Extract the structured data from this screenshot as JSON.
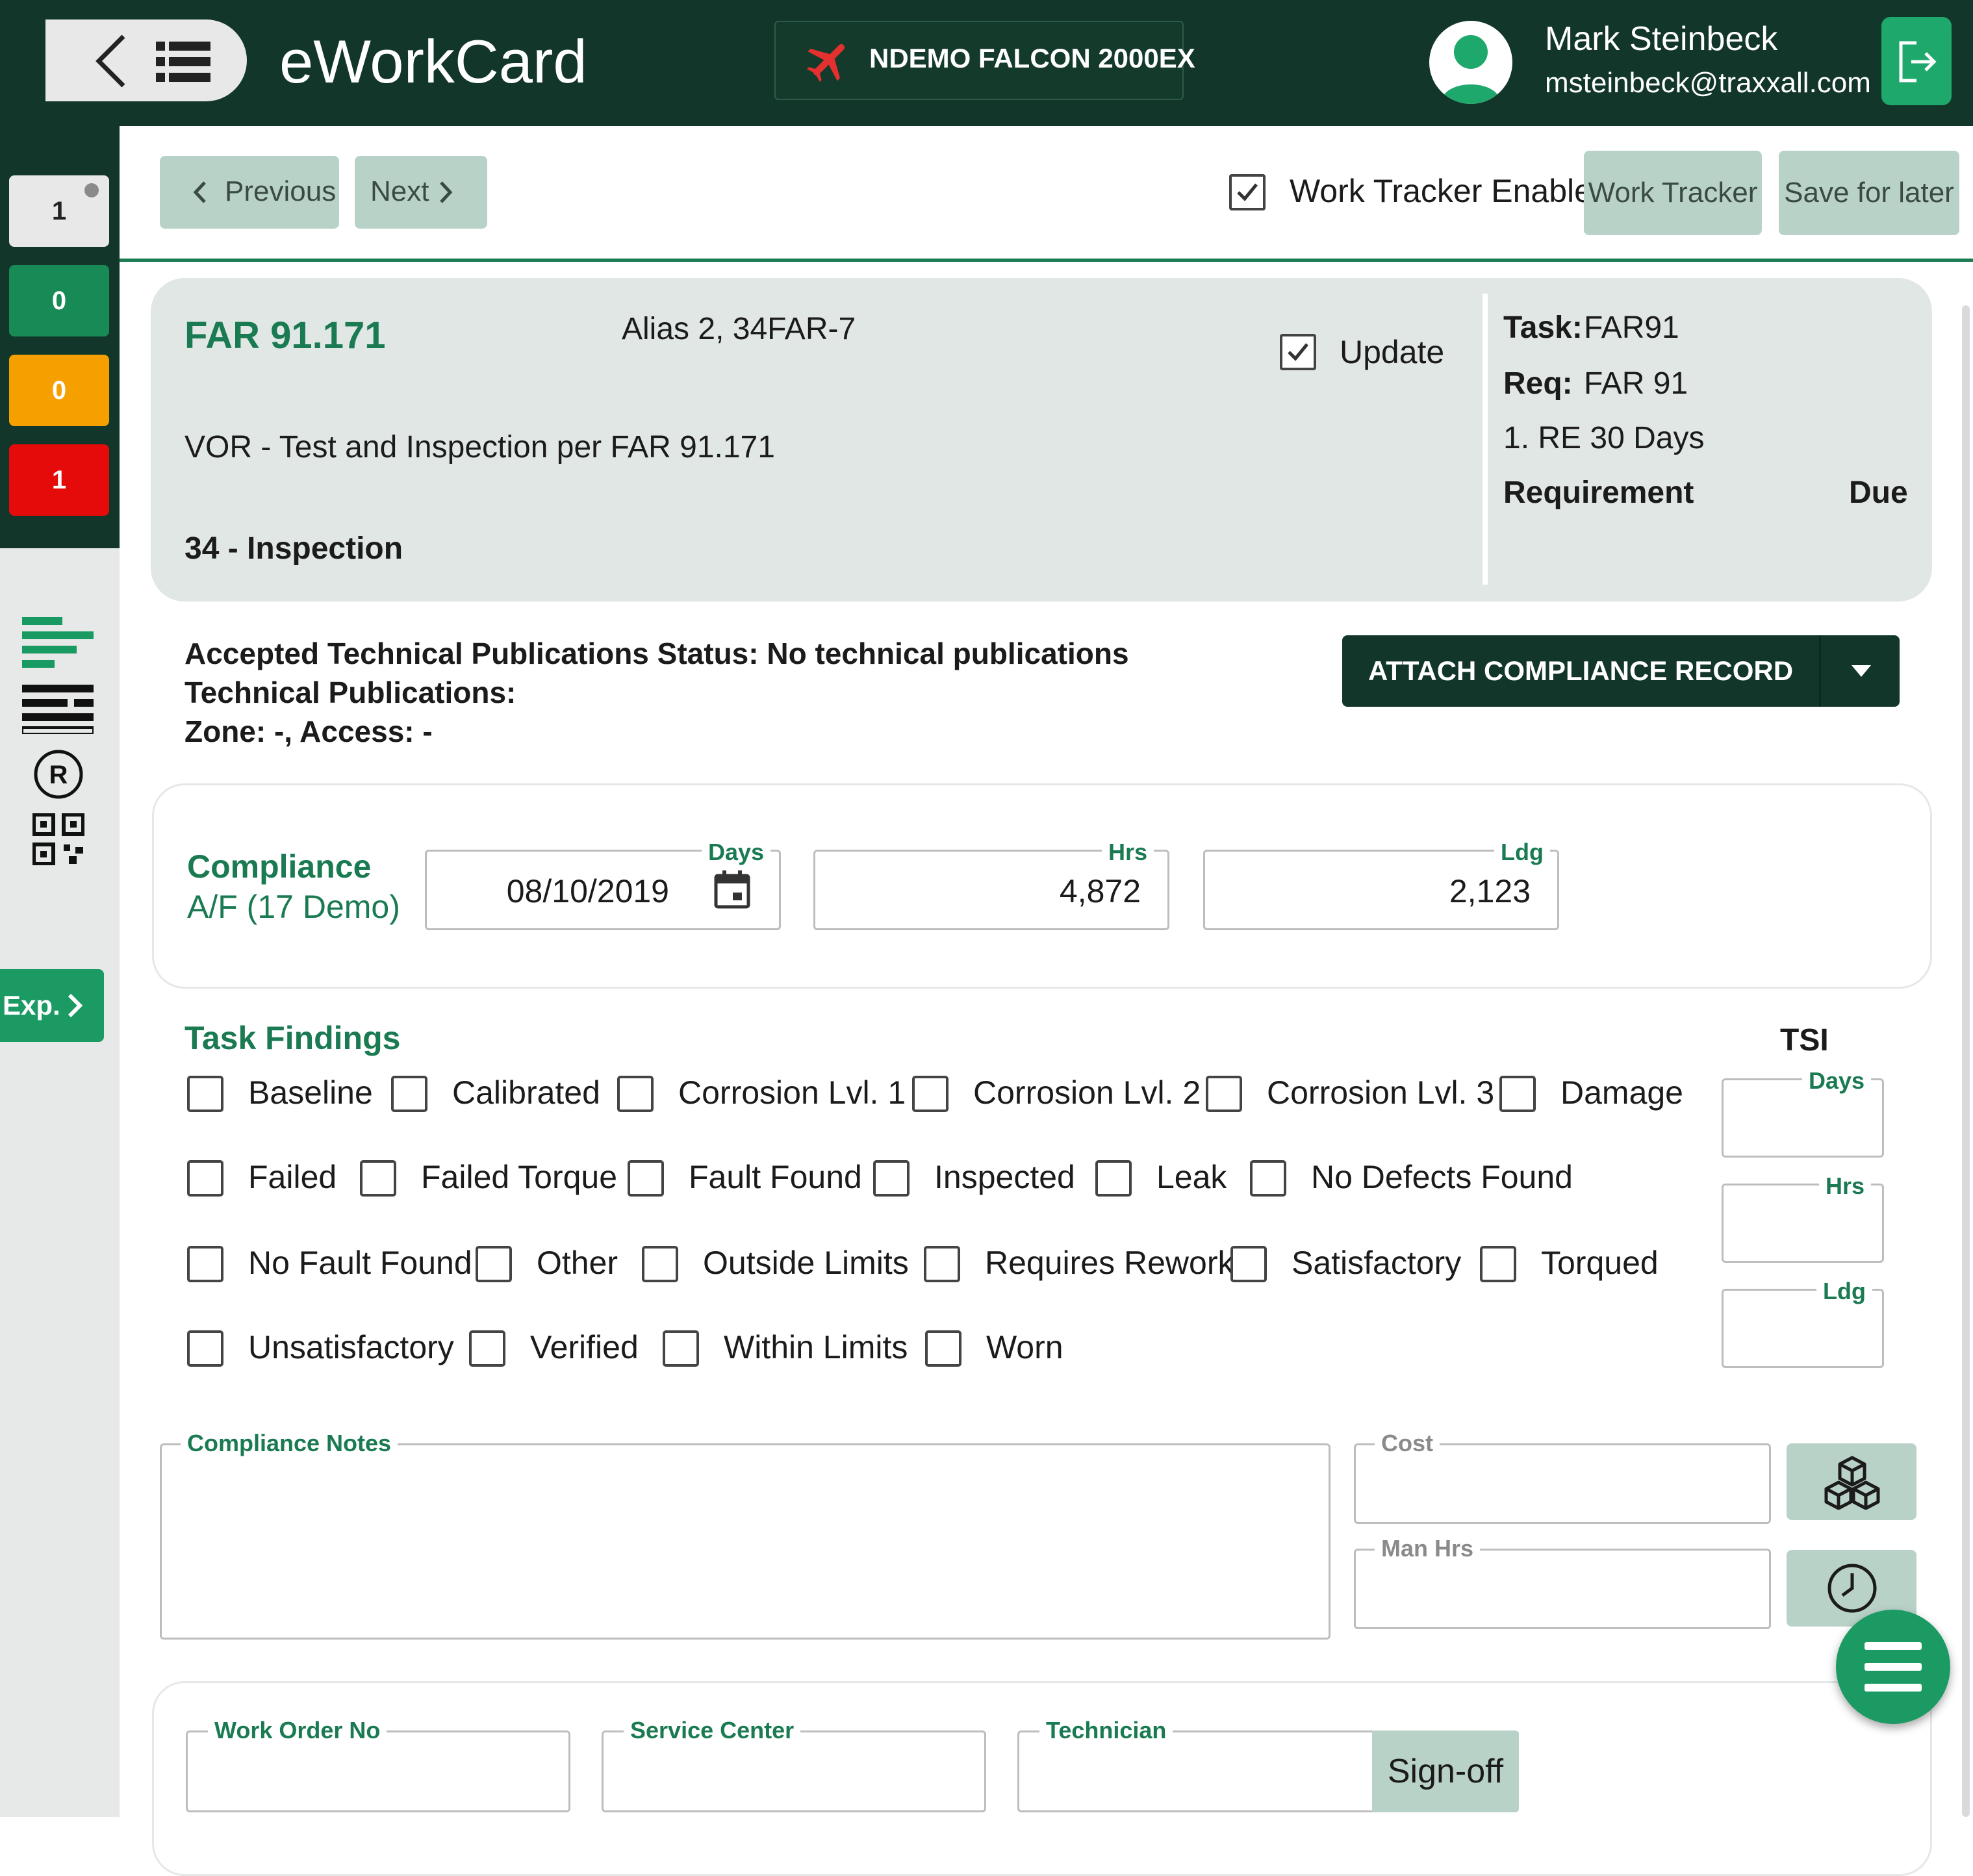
{
  "app": {
    "title": "eWorkCard"
  },
  "aircraft": {
    "label": "NDEMO FALCON 2000EX"
  },
  "user": {
    "name": "Mark Steinbeck",
    "email": "msteinbeck@traxxall.com"
  },
  "counters": [
    "1",
    "0",
    "0",
    "1"
  ],
  "rail": {
    "exp_label": "Exp."
  },
  "toolbar": {
    "previous_label": "Previous",
    "next_label": "Next",
    "work_tracker_enabled_label": "Work Tracker Enabled",
    "work_tracker_enabled_checked": true,
    "work_tracker_label": "Work Tracker",
    "save_label": "Save for later"
  },
  "task": {
    "code": "FAR 91.171",
    "alias": "Alias 2, 34FAR-7",
    "update_label": "Update",
    "update_checked": true,
    "description": "VOR - Test and Inspection per FAR 91.171",
    "category": "34 - Inspection",
    "task_label": "Task:",
    "task_value": "FAR91",
    "req_label": "Req:",
    "req_value": "FAR 91",
    "interval": "1. RE 30 Days",
    "requirement_label": "Requirement",
    "due_label": "Due"
  },
  "publications": {
    "status": "Accepted Technical Publications Status: No technical publications",
    "tech_pubs": "Technical Publications:",
    "zone": "Zone: -, Access: -",
    "attach_label": "ATTACH COMPLIANCE RECORD FILE"
  },
  "compliance": {
    "title": "Compliance",
    "subtitle": "A/F (17 Demo)",
    "days_label": "Days",
    "days_value": "08/10/2019",
    "hrs_label": "Hrs",
    "hrs_value": "4,872",
    "ldg_label": "Ldg",
    "ldg_value": "2,123"
  },
  "findings": {
    "title": "Task Findings",
    "rows": [
      [
        "Baseline",
        "Calibrated",
        "Corrosion Lvl. 1",
        "Corrosion Lvl. 2",
        "Corrosion Lvl. 3",
        "Damage"
      ],
      [
        "Failed",
        "Failed Torque",
        "Fault Found",
        "Inspected",
        "Leak",
        "No Defects Found"
      ],
      [
        "No Fault Found",
        "Other",
        "Outside Limits",
        "Requires Rework",
        "Satisfactory",
        "Torqued"
      ],
      [
        "Unsatisfactory",
        "Verified",
        "Within Limits",
        "Worn"
      ]
    ]
  },
  "tsi": {
    "title": "TSI",
    "days_label": "Days",
    "hrs_label": "Hrs",
    "ldg_label": "Ldg"
  },
  "notes": {
    "compliance_notes_label": "Compliance Notes",
    "cost_label": "Cost",
    "man_hrs_label": "Man Hrs"
  },
  "signoff": {
    "work_order_label": "Work Order No",
    "service_center_label": "Service Center",
    "technician_label": "Technician",
    "signoff_label": "Sign-off"
  },
  "icons": [
    "back-arrow-icon",
    "list-icon",
    "airplane-icon",
    "user-avatar-icon",
    "logout-icon",
    "calendar-icon",
    "parts-icon",
    "clock-icon",
    "menu-icon",
    "checkbox-icon"
  ],
  "colors": {
    "brand_dark": "#123629",
    "accent_green": "#1a7a52",
    "button_green": "#b9d2c8",
    "warning": "#f6a000",
    "danger": "#e50b0b"
  }
}
